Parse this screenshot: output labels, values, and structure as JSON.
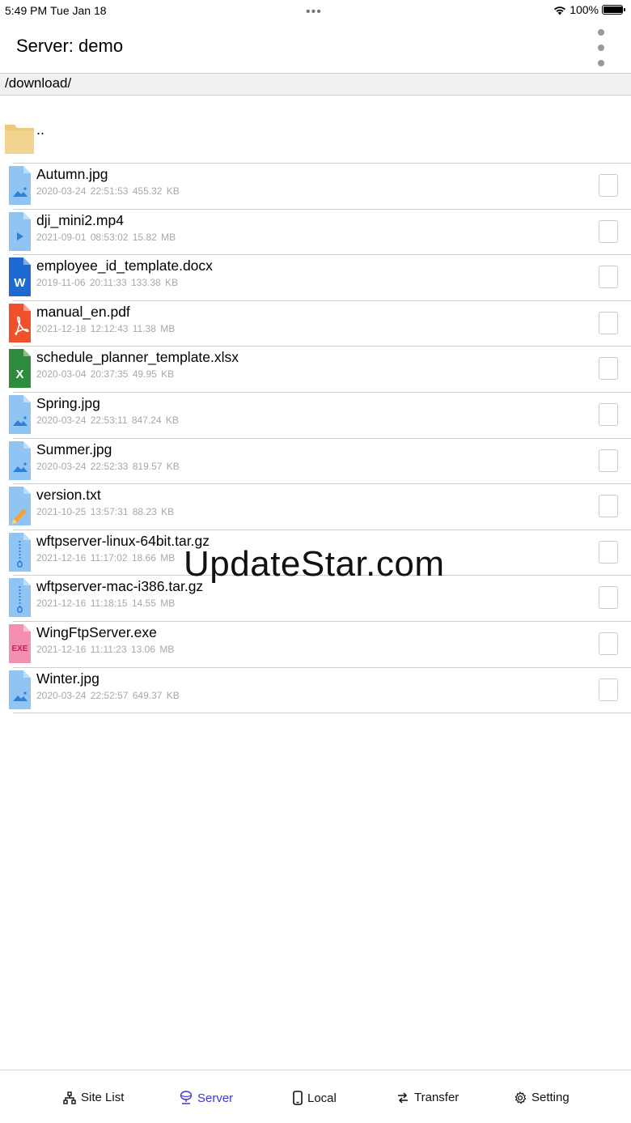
{
  "status_bar": {
    "time": "5:49 PM",
    "date": "Tue Jan 18",
    "battery": "100%",
    "battery_level": 1.0
  },
  "nav": {
    "title": "Server:  demo",
    "more_icon": "more-vertical-icon"
  },
  "path": "/download/",
  "parent": {
    "label": "..",
    "icon": "folder-icon"
  },
  "files": [
    {
      "name": "Autumn.jpg",
      "meta": "2020-03-24 22:51:53  455.32 KB",
      "icon": "image-file-icon"
    },
    {
      "name": "dji_mini2.mp4",
      "meta": "2021-09-01 08:53:02  15.82 MB",
      "icon": "video-file-icon"
    },
    {
      "name": "employee_id_template.docx",
      "meta": "2019-11-06 20:11:33  133.38 KB",
      "icon": "word-file-icon"
    },
    {
      "name": "manual_en.pdf",
      "meta": "2021-12-18 12:12:43  11.38 MB",
      "icon": "pdf-file-icon"
    },
    {
      "name": "schedule_planner_template.xlsx",
      "meta": "2020-03-04 20:37:35  49.95 KB",
      "icon": "excel-file-icon"
    },
    {
      "name": "Spring.jpg",
      "meta": "2020-03-24 22:53:11  847.24 KB",
      "icon": "image-file-icon"
    },
    {
      "name": "Summer.jpg",
      "meta": "2020-03-24 22:52:33  819.57 KB",
      "icon": "image-file-icon"
    },
    {
      "name": "version.txt",
      "meta": "2021-10-25 13:57:31  88.23 KB",
      "icon": "text-file-icon"
    },
    {
      "name": "wftpserver-linux-64bit.tar.gz",
      "meta": "2021-12-16 11:17:02  18.66 MB",
      "icon": "archive-file-icon"
    },
    {
      "name": "wftpserver-mac-i386.tar.gz",
      "meta": "2021-12-16 11:18:15  14.55 MB",
      "icon": "archive-file-icon"
    },
    {
      "name": "WingFtpServer.exe",
      "meta": "2021-12-16 11:11:23  13.06 MB",
      "icon": "exe-file-icon"
    },
    {
      "name": "Winter.jpg",
      "meta": "2020-03-24 22:52:57  649.37 KB",
      "icon": "image-file-icon"
    }
  ],
  "watermark": "UpdateStar.com",
  "tabs": [
    {
      "label": "Site List",
      "icon": "sitemap-icon",
      "active": false
    },
    {
      "label": "Server",
      "icon": "server-icon",
      "active": true
    },
    {
      "label": "Local",
      "icon": "phone-icon",
      "active": false
    },
    {
      "label": "Transfer",
      "icon": "transfer-icon",
      "active": false
    },
    {
      "label": "Setting",
      "icon": "gear-icon",
      "active": false
    }
  ],
  "colors": {
    "accent": "#3a3ad4",
    "file_blue": "#8fc4f3",
    "file_blue_dark": "#2f7fd8",
    "word": "#1f6ad1",
    "pdf": "#f0512c",
    "excel": "#2e8b3e",
    "exe": "#f48fb1",
    "folder": "#ecca7a"
  }
}
